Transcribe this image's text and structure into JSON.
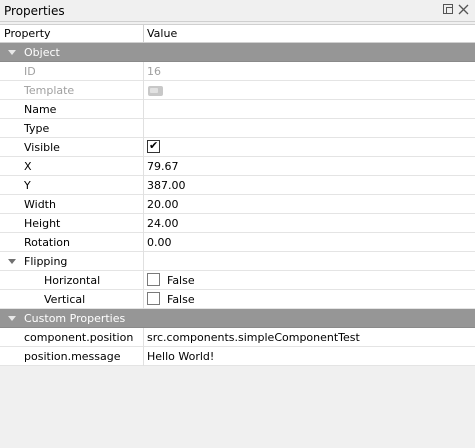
{
  "panel": {
    "title": "Properties",
    "float_icon": "float-icon",
    "close_icon": "close-icon"
  },
  "header": {
    "property": "Property",
    "value": "Value"
  },
  "object_group": {
    "label": "Object",
    "icon": "chevron-down-icon"
  },
  "rows": {
    "id": {
      "label": "ID",
      "value": "16"
    },
    "template": {
      "label": "Template",
      "icon": "template-icon"
    },
    "name": {
      "label": "Name",
      "value": ""
    },
    "type": {
      "label": "Type",
      "value": ""
    },
    "visible": {
      "label": "Visible",
      "checked": true
    },
    "x": {
      "label": "X",
      "value": "79.67"
    },
    "y": {
      "label": "Y",
      "value": "387.00"
    },
    "width": {
      "label": "Width",
      "value": "20.00"
    },
    "height": {
      "label": "Height",
      "value": "24.00"
    },
    "rotation": {
      "label": "Rotation",
      "value": "0.00"
    }
  },
  "flipping": {
    "label": "Flipping",
    "horizontal": {
      "label": "Horizontal",
      "checked": false,
      "value": "False"
    },
    "vertical": {
      "label": "Vertical",
      "checked": false,
      "value": "False"
    }
  },
  "custom_group": {
    "label": "Custom Properties"
  },
  "custom_rows": [
    {
      "label": "component.position",
      "value": "src.components.simpleComponentTest"
    },
    {
      "label": "position.message",
      "value": "Hello World!"
    }
  ],
  "colors": {
    "group_bg": "#969696",
    "panel_bg": "#f0f0f0",
    "row_bg": "#ffffff",
    "disabled_text": "#a0a0a0"
  }
}
